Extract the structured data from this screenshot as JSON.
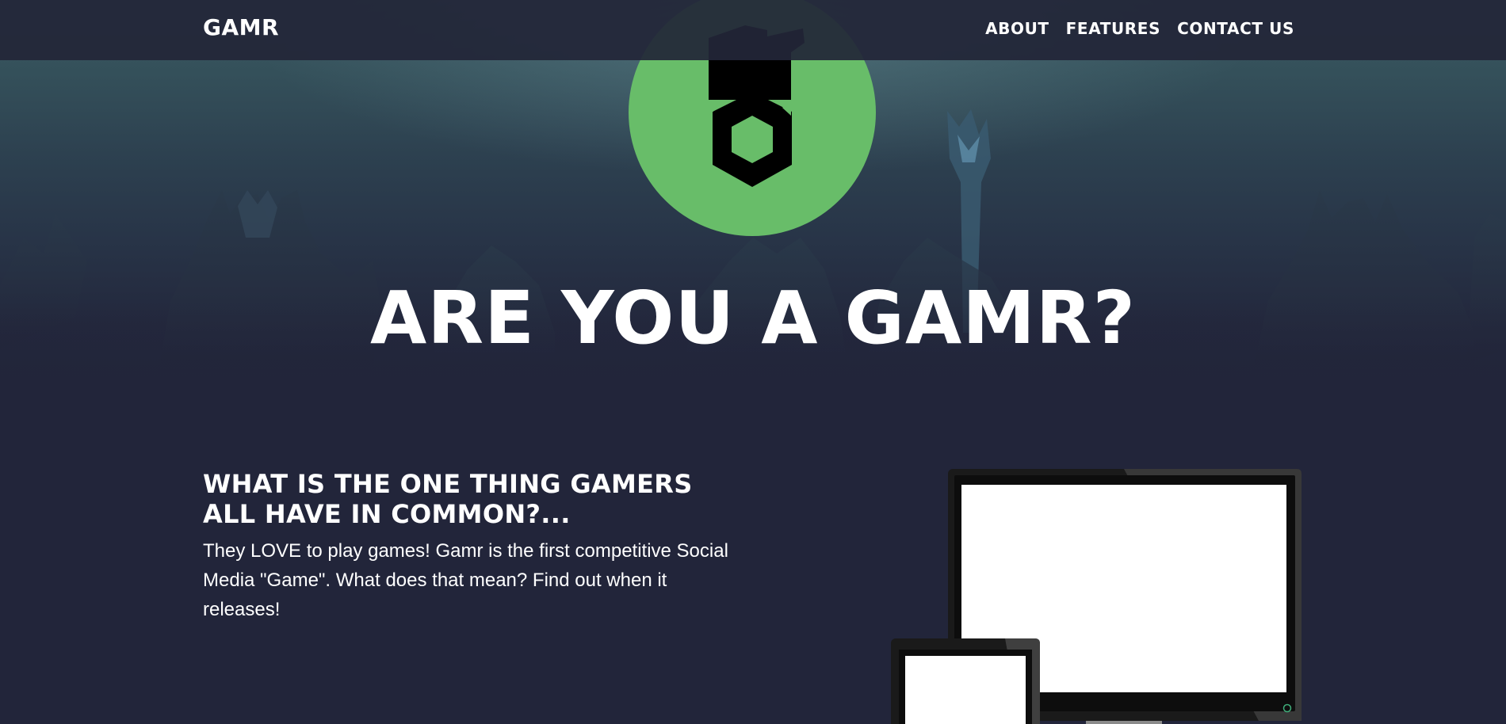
{
  "nav": {
    "brand": "GAMR",
    "links": [
      {
        "label": "ABOUT"
      },
      {
        "label": "FEATURES"
      },
      {
        "label": "CONTACT US"
      }
    ]
  },
  "hero": {
    "title": "ARE YOU A GAMR?",
    "logo_icon": "gamr-logo-icon"
  },
  "section": {
    "heading": "WHAT IS THE ONE THING GAMERS ALL HAVE IN COMMON?...",
    "body": "They LOVE to play games! Gamr is the first competitive Social Media \"Game\". What does that mean? Find out when it releases!"
  },
  "colors": {
    "background": "#22253a",
    "navbar": "#222638",
    "accent_green": "#68bd69",
    "text": "#ffffff"
  },
  "devices_icon": "monitor-and-tablet-mockup-icon"
}
